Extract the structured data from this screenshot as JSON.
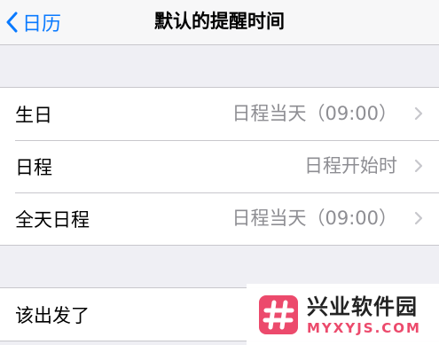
{
  "navbar": {
    "back_label": "日历",
    "title": "默认的提醒时间"
  },
  "group1": {
    "rows": [
      {
        "label": "生日",
        "value": "日程当天（09:00）"
      },
      {
        "label": "日程",
        "value": "日程开始时"
      },
      {
        "label": "全天日程",
        "value": "日程当天（09:00）"
      }
    ]
  },
  "group2": {
    "rows": [
      {
        "label": "该出发了"
      }
    ]
  },
  "watermark": {
    "name": "兴业软件园",
    "url": "MYXYJS.COM"
  },
  "colors": {
    "accent": "#0a7aff",
    "background": "#efeff4",
    "secondary_text": "#8e8e93",
    "separator": "#c8c7cc",
    "watermark_pink": "#ec4a6c"
  },
  "icons": [
    "chevron-left-icon",
    "chevron-right-icon",
    "hash-logo-icon"
  ]
}
